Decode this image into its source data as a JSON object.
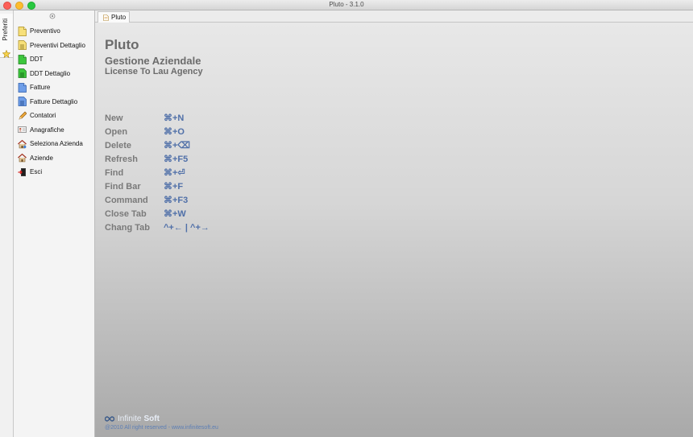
{
  "window": {
    "title": "Pluto - 3.1.0"
  },
  "vertical_tab": {
    "label": "Preferiti",
    "icon": "star-icon"
  },
  "sidebar": {
    "items": [
      {
        "label": "Preventivo",
        "icon": "yellow-document-icon"
      },
      {
        "label": "Preventivi Dettaglio",
        "icon": "yellow-document-list-icon"
      },
      {
        "label": "DDT",
        "icon": "green-document-icon"
      },
      {
        "label": "DDT Dettaglio",
        "icon": "green-document-list-icon"
      },
      {
        "label": "Fatture",
        "icon": "blue-document-icon"
      },
      {
        "label": "Fatture Dettaglio",
        "icon": "blue-document-list-icon"
      },
      {
        "label": "Contatori",
        "icon": "pencil-icon"
      },
      {
        "label": "Anagrafiche",
        "icon": "address-card-icon"
      },
      {
        "label": "Seleziona Azienda",
        "icon": "house-select-icon"
      },
      {
        "label": "Aziende",
        "icon": "house-icon"
      },
      {
        "label": "Esci",
        "icon": "exit-door-icon"
      }
    ]
  },
  "tabs": [
    {
      "label": "Pluto",
      "icon": "document-icon"
    }
  ],
  "welcome": {
    "title": "Pluto",
    "subtitle": "Gestione Aziendale",
    "license": "License To Lau Agency",
    "shortcuts": [
      {
        "name": "New",
        "keys": "⌘+N"
      },
      {
        "name": "Open",
        "keys": "⌘+O"
      },
      {
        "name": "Delete",
        "keys": "⌘+⌫"
      },
      {
        "name": "Refresh",
        "keys": "⌘+F5"
      },
      {
        "name": "Find",
        "keys": "⌘+⏎"
      },
      {
        "name": "Find Bar",
        "keys": "⌘+F"
      },
      {
        "name": "Command",
        "keys": "⌘+F3"
      },
      {
        "name": "Close Tab",
        "keys": "⌘+W"
      },
      {
        "name": "Chang Tab",
        "keys": "^+← | ^+→"
      }
    ]
  },
  "footer": {
    "brand_light": "Infinite",
    "brand_bold": "Soft",
    "copyright": "@2010 All right reserved - www.infinitesoft.eu"
  },
  "colors": {
    "accent": "#4f6fa8",
    "text_muted": "#6b6b6b"
  }
}
